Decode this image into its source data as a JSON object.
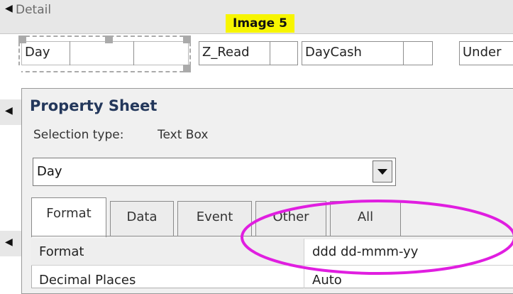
{
  "detail_band": {
    "label": "Detail",
    "arrow_icon": "section-expand-icon"
  },
  "image_tag": {
    "text": "Image 5",
    "color": "#f7f500"
  },
  "controls": {
    "day": "Day",
    "z_read": "Z_Read",
    "day_cash": "DayCash",
    "under": "Under"
  },
  "property_sheet": {
    "title": "Property Sheet",
    "selection_type_label": "Selection type:",
    "selection_type_value": "Text Box",
    "object_select_value": "Day",
    "tabs": [
      "Format",
      "Data",
      "Event",
      "Other",
      "All"
    ],
    "active_tab": "Format",
    "rows": [
      {
        "name": "Format",
        "value": "ddd dd-mmm-yy"
      },
      {
        "name": "Decimal Places",
        "value": "Auto"
      }
    ]
  },
  "colors": {
    "highlight": "#e01ee0",
    "title": "#23375b"
  }
}
